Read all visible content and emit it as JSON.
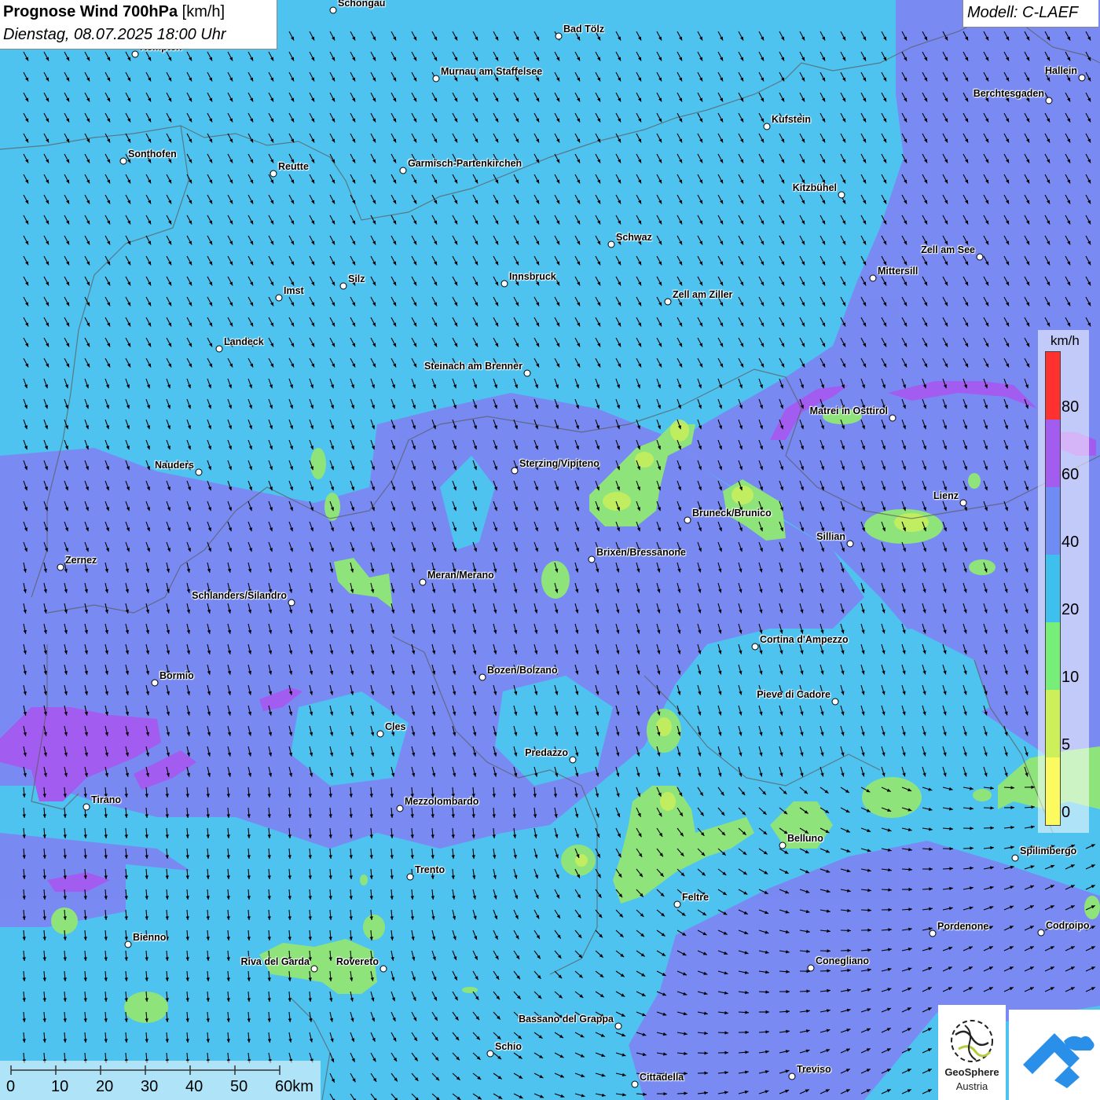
{
  "header": {
    "title_bold": "Prognose Wind 700hPa",
    "title_unit": "[km/h]",
    "datetime": "Dienstag, 08.07.2025 18:00 Uhr",
    "model": "Modell: C-LAEF"
  },
  "legend": {
    "unit": "km/h",
    "labels": [
      "80",
      "60",
      "40",
      "20",
      "10",
      "5",
      "0"
    ],
    "colors": [
      "#ff3030",
      "#a35cf0",
      "#6f8cf5",
      "#3ec0ef",
      "#77ee77",
      "#cdf05a",
      "#fbfb60"
    ]
  },
  "scale": {
    "labels": [
      "0",
      "10",
      "20",
      "30",
      "40",
      "50",
      "60km"
    ]
  },
  "colors": {
    "base": "#4fc3f0",
    "band_20_40": "#6f8cf5",
    "band_40_60": "#7b88f2",
    "band_60_80": "#a35cf0",
    "band_5_10": "#8ee47a",
    "band_0_5": "#cdf05a"
  },
  "logos": {
    "geosphere_line1": "GeoSphere",
    "geosphere_line2": "Austria"
  },
  "cities": [
    {
      "name": "Schongau"
    },
    {
      "name": "Bad Tölz"
    },
    {
      "name": "Kempten"
    },
    {
      "name": "Murnau am Staffelsee"
    },
    {
      "name": "Hallein"
    },
    {
      "name": "Berchtesgaden"
    },
    {
      "name": "Kufstein"
    },
    {
      "name": "Sonthofen"
    },
    {
      "name": "Reutte"
    },
    {
      "name": "Garmisch-Partenkirchen"
    },
    {
      "name": "Kitzbühel"
    },
    {
      "name": "Schwaz"
    },
    {
      "name": "Zell am See"
    },
    {
      "name": "Mittersill"
    },
    {
      "name": "Innsbruck"
    },
    {
      "name": "Silz"
    },
    {
      "name": "Imst"
    },
    {
      "name": "Zell am Ziller"
    },
    {
      "name": "Landeck"
    },
    {
      "name": "Steinach am Brenner"
    },
    {
      "name": "Matrei in Osttirol"
    },
    {
      "name": "Nauders"
    },
    {
      "name": "Sterzing/Vipiteno"
    },
    {
      "name": "Lienz"
    },
    {
      "name": "Bruneck/Brunico"
    },
    {
      "name": "Sillian"
    },
    {
      "name": "Brixen/Bressanone"
    },
    {
      "name": "Zernez"
    },
    {
      "name": "Meran/Merano"
    },
    {
      "name": "Schlanders/Silandro"
    },
    {
      "name": "Cortina d'Ampezzo"
    },
    {
      "name": "Bozen/Bolzano"
    },
    {
      "name": "Bormio"
    },
    {
      "name": "Pieve di Cadore"
    },
    {
      "name": "Cles"
    },
    {
      "name": "Predazzo"
    },
    {
      "name": "Tirano"
    },
    {
      "name": "Mezzolombardo"
    },
    {
      "name": "Belluno"
    },
    {
      "name": "Spilimbergo"
    },
    {
      "name": "Trento"
    },
    {
      "name": "Feltre"
    },
    {
      "name": "Pordenone"
    },
    {
      "name": "Codroipo"
    },
    {
      "name": "Bienno"
    },
    {
      "name": "Riva del Garda"
    },
    {
      "name": "Rovereto"
    },
    {
      "name": "Conegliano"
    },
    {
      "name": "Bassano del Grappa"
    },
    {
      "name": "Schio"
    },
    {
      "name": "Treviso"
    },
    {
      "name": "Cittadella"
    }
  ]
}
